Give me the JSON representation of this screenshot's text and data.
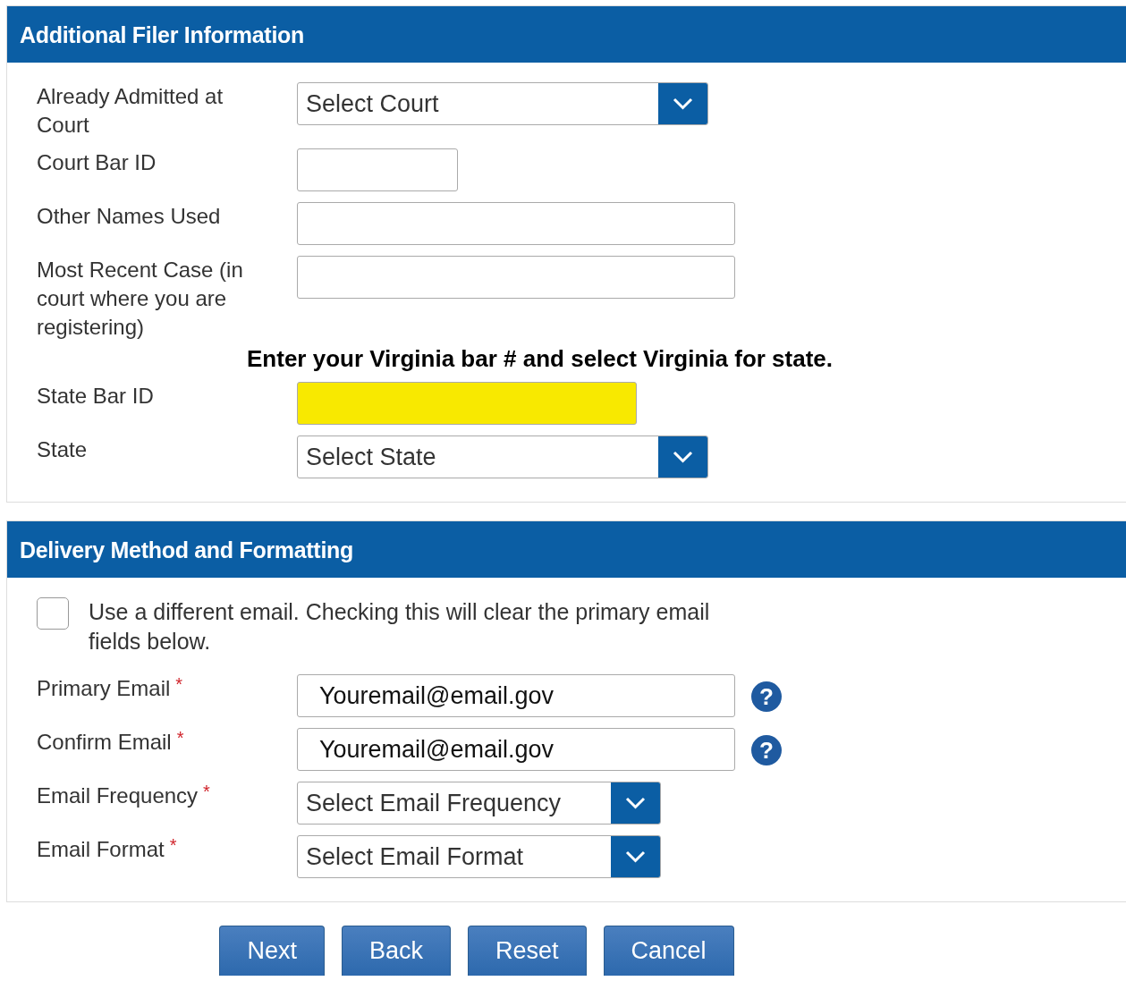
{
  "sections": [
    {
      "title": "Additional Filer Information",
      "fields": [
        {
          "kind": "select",
          "label": "Already Admitted at Court",
          "value": "Select Court"
        },
        {
          "kind": "text",
          "label": "Court Bar ID"
        },
        {
          "kind": "text",
          "label": "Other Names Used"
        },
        {
          "kind": "text",
          "label": "Most Recent Case (in court where you are registering)"
        },
        {
          "kind": "note",
          "text": "Enter your Virginia bar # and select Virginia for state."
        },
        {
          "kind": "text",
          "label": "State Bar ID",
          "highlighted": true
        },
        {
          "kind": "select",
          "label": "State",
          "value": "Select State"
        }
      ]
    },
    {
      "title": "Delivery Method and Formatting",
      "fields": [
        {
          "kind": "checkbox",
          "label": "Use a different email. Checking this will clear the primary email fields below.",
          "checked": false
        },
        {
          "kind": "text",
          "label": "Primary Email",
          "required_mark": "*",
          "value": "Youremail@email.gov",
          "help": "?"
        },
        {
          "kind": "text",
          "label": "Confirm Email",
          "required_mark": "*",
          "value": "Youremail@email.gov",
          "help": "?"
        },
        {
          "kind": "select",
          "label": "Email Frequency",
          "required_mark": "*",
          "value": "Select Email Frequency"
        },
        {
          "kind": "select",
          "label": "Email Format",
          "required_mark": "*",
          "value": "Select Email Format"
        }
      ]
    }
  ],
  "buttons": [
    "Next",
    "Back",
    "Reset",
    "Cancel"
  ]
}
